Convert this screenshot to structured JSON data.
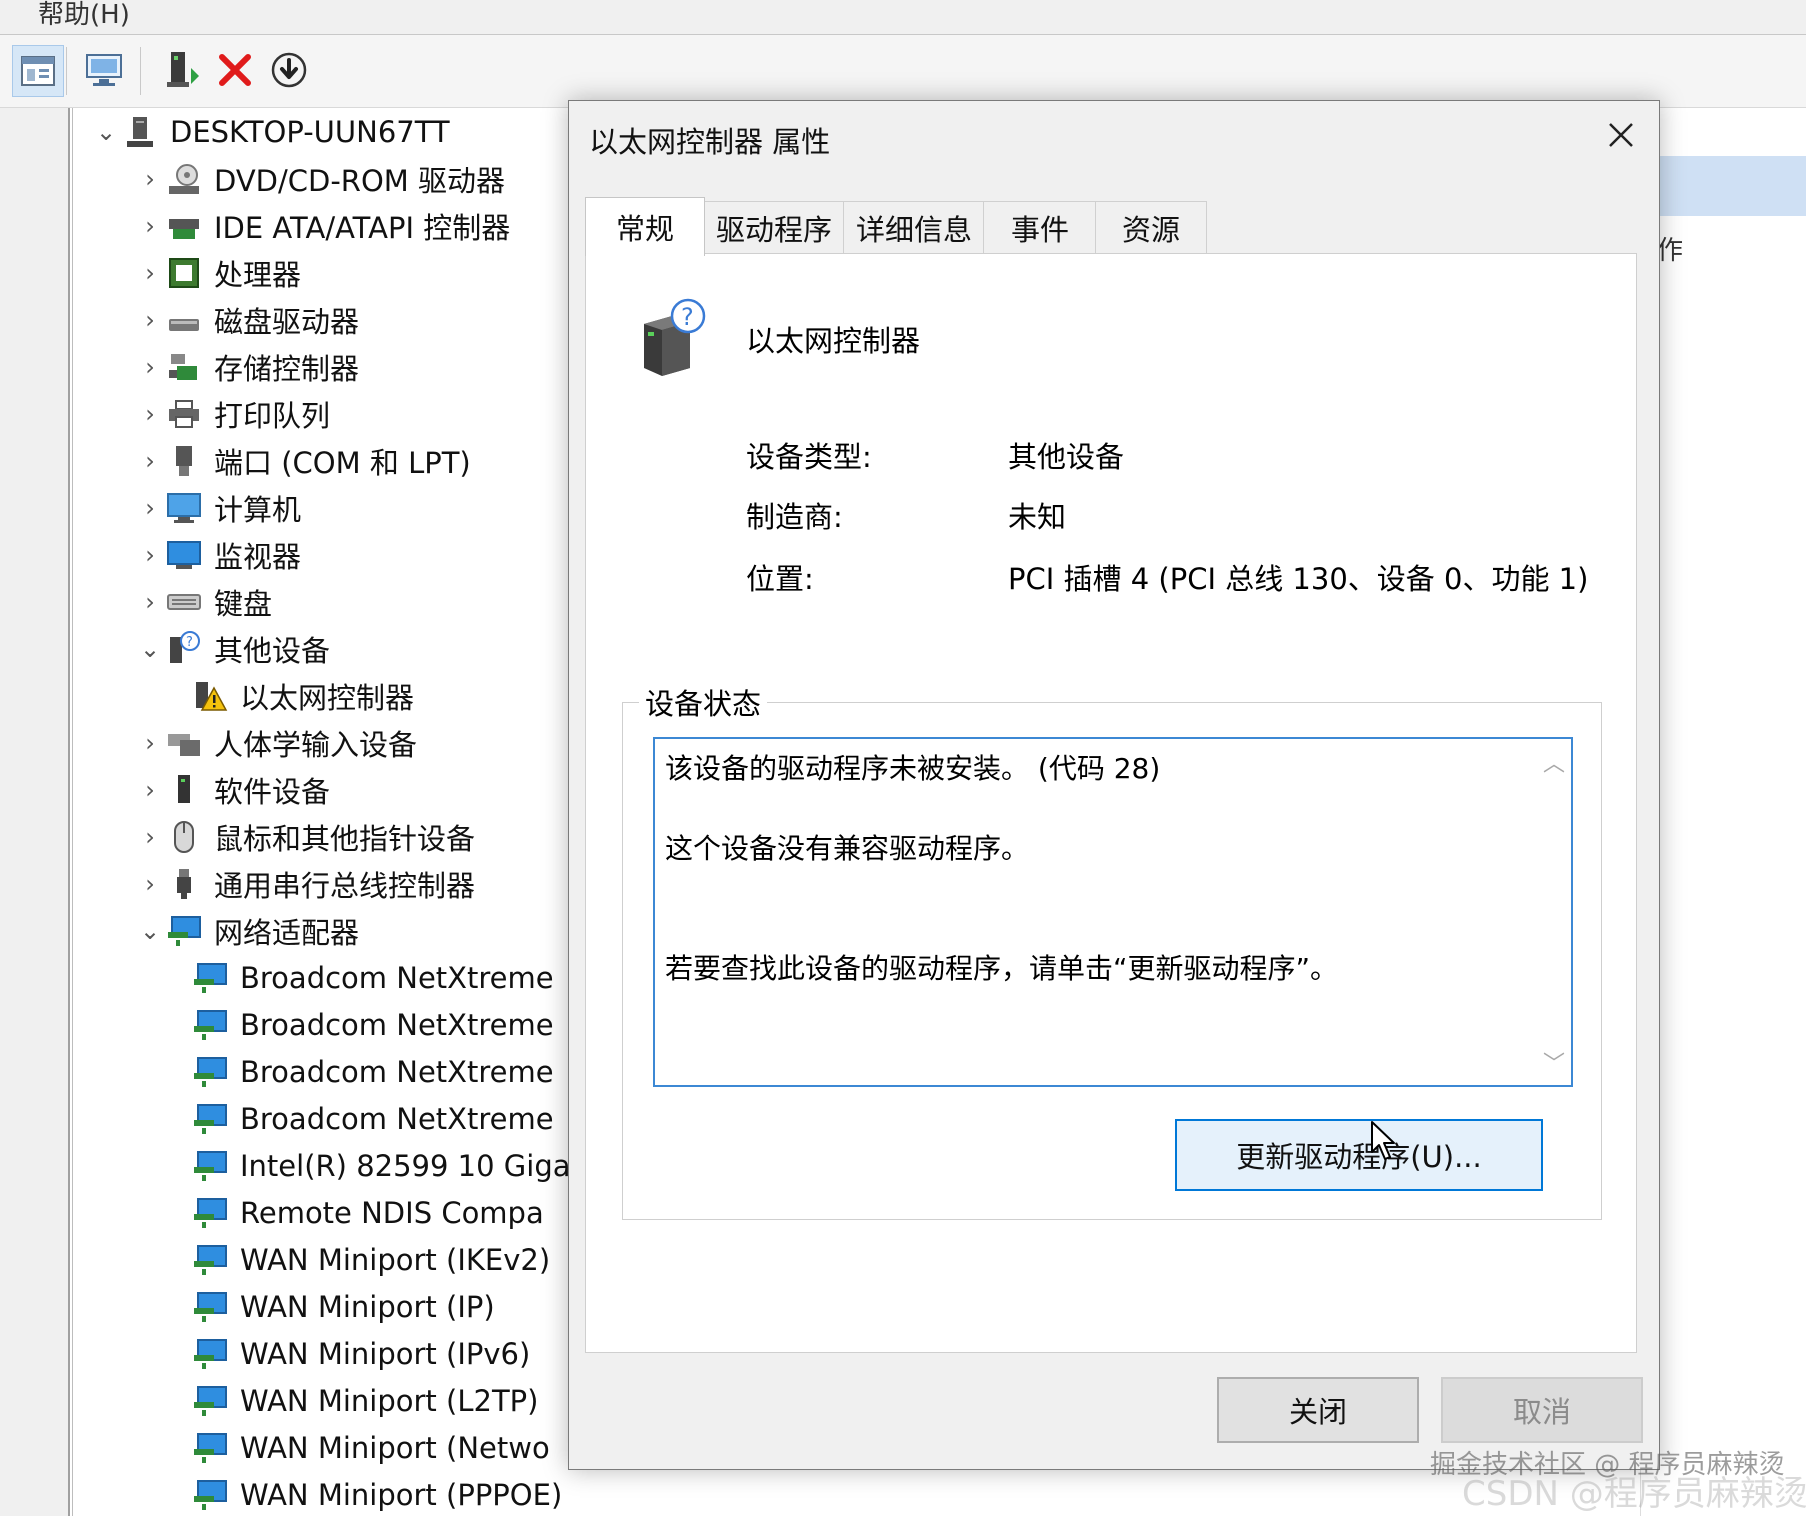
{
  "menubar": {
    "help_label": "帮助(H)"
  },
  "toolbar": {
    "buttons": [
      "properties-icon",
      "scan-hardware-icon",
      "update-driver-icon",
      "uninstall-icon",
      "disable-icon"
    ]
  },
  "tree": {
    "root": "DESKTOP-UUN67TT",
    "items": [
      "DVD/CD-ROM 驱动器",
      "IDE ATA/ATAPI 控制器",
      "处理器",
      "磁盘驱动器",
      "存储控制器",
      "打印队列",
      "端口 (COM 和 LPT)",
      "计算机",
      "监视器",
      "键盘",
      "其他设备",
      "以太网控制器",
      "人体学输入设备",
      "软件设备",
      "鼠标和其他指针设备",
      "通用串行总线控制器",
      "网络适配器",
      "Broadcom NetXtreme",
      "Broadcom NetXtreme",
      "Broadcom NetXtreme",
      "Broadcom NetXtreme",
      "Intel(R) 82599 10 Giga",
      "Remote NDIS Compa",
      "WAN Miniport (IKEv2)",
      "WAN Miniport (IP)",
      "WAN Miniport (IPv6)",
      "WAN Miniport (L2TP)",
      "WAN Miniport (Netwo",
      "WAN Miniport (PPPOE)"
    ]
  },
  "right_pane": {
    "text": "作"
  },
  "dialog": {
    "title": "以太网控制器 属性",
    "tabs": [
      "常规",
      "驱动程序",
      "详细信息",
      "事件",
      "资源"
    ],
    "active_tab": "常规",
    "device_name": "以太网控制器",
    "properties": [
      {
        "label": "设备类型:",
        "value": "其他设备"
      },
      {
        "label": "制造商:",
        "value": "未知"
      },
      {
        "label": "位置:",
        "value": "PCI 插槽 4 (PCI 总线 130、设备 0、功能 1)"
      }
    ],
    "status_group_title": "设备状态",
    "status_lines": [
      "该设备的驱动程序未被安装。 (代码 28)",
      "这个设备没有兼容驱动程序。",
      "若要查找此设备的驱动程序，请单击“更新驱动程序”。"
    ],
    "update_button": "更新驱动程序(U)...",
    "close_button": "关闭",
    "cancel_button": "取消"
  },
  "watermark": {
    "line1": "掘金技术社区 @ 程序员麻辣烫",
    "line2": "CSDN @程序员麻辣烫"
  },
  "colors": {
    "accent": "#0078d7",
    "status_border": "#3c88d4",
    "button_hover": "#e5f1fb"
  }
}
